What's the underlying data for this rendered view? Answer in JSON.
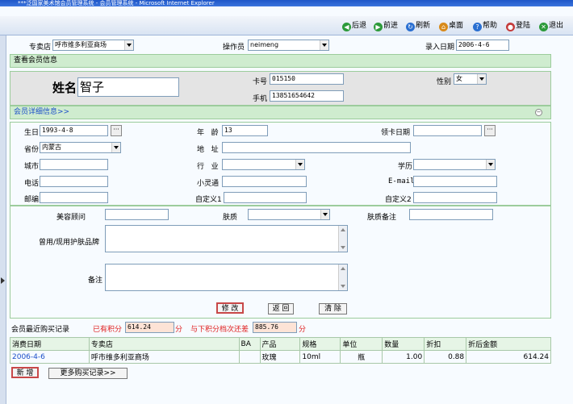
{
  "window": {
    "title": "***泛国家美术馆会员管理系统 - 会员管理系统 - Microsoft Internet Explorer"
  },
  "toolbar": {
    "back": "后退",
    "forward": "前进",
    "refresh": "刷新",
    "desktop": "桌面",
    "help": "帮助",
    "login": "登陆",
    "exit": "退出"
  },
  "header": {
    "store_label": "专卖店",
    "store_value": "呼市维多利亚商场",
    "operator_label": "操作员",
    "operator_value": "neimeng",
    "date_label": "录入日期",
    "date_value": "2006-4-6"
  },
  "view_section": {
    "title": "查看会员信息",
    "name_label": "姓名",
    "name_value": "智子",
    "card_label": "卡号",
    "card_value": "015150",
    "mobile_label": "手机",
    "mobile_value": "13851654642",
    "gender_label": "性别",
    "gender_value": "女"
  },
  "detail_section": {
    "title": "会员详细信息>>",
    "birthday_label": "生日",
    "birthday_value": "1993-4-8",
    "age_label": "年   龄",
    "age_value": "13",
    "card_date_label": "领卡日期",
    "card_date_value": "",
    "province_label": "省份",
    "province_value": "内蒙古",
    "address_label": "地   址",
    "address_value": "",
    "city_label": "城市",
    "city_value": "",
    "industry_label": "行   业",
    "industry_value": "",
    "education_label": "学历",
    "education_value": "",
    "phone_label": "电话",
    "phone_value": "",
    "pas_label": "小灵通",
    "pas_value": "",
    "email_label": "E-mail",
    "email_value": "",
    "zip_label": "邮编",
    "zip_value": "",
    "custom1_label": "自定义1",
    "custom1_value": "",
    "custom2_label": "自定义2",
    "custom2_value": ""
  },
  "beauty_section": {
    "advisor_label": "美容顾问",
    "skin_label": "肤质",
    "skin_note_label": "肤质备注",
    "brand_label": "曾用/现用护肤品牌",
    "remark_label": "备注"
  },
  "actions": {
    "modify": "修 改",
    "back": "返 回",
    "clear": "清 除"
  },
  "points": {
    "recent_label": "会员最近购买记录",
    "points_label": "已有积分",
    "points_value": "614.24",
    "unit": "分",
    "next_label": "与下积分档次还差",
    "next_value": "885.76",
    "next_unit": "分"
  },
  "purchases": {
    "headers": [
      "消费日期",
      "专卖店",
      "BA",
      "产品",
      "规格",
      "单位",
      "数量",
      "折扣",
      "折后金额"
    ],
    "rows": [
      [
        "2006-4-6",
        "呼市维多利亚商场",
        "",
        "玫瑰",
        "10ml",
        "瓶",
        "1.00",
        "0.88",
        "614.24"
      ]
    ]
  },
  "footer": {
    "add": "新 增",
    "more": "更多购买记录>>"
  }
}
